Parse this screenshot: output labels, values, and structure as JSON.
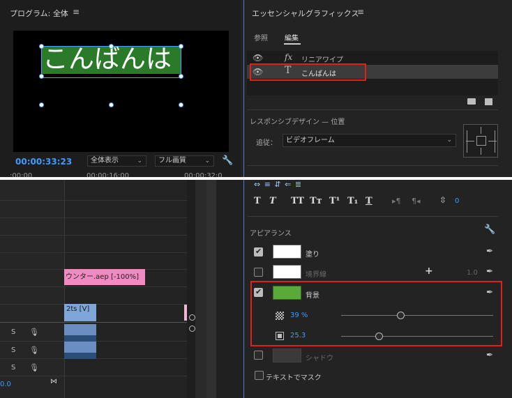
{
  "program_monitor": {
    "title": "プログラム: 全体",
    "menu_icon": "hamburger-icon",
    "title_text": "こんばんは",
    "timecode": "00:00:33:23",
    "fit_dropdown": "全体表示",
    "quality_dropdown": "フル画質",
    "wrench_icon": "wrench-icon",
    "ruler": [
      ":00:00",
      "00:00:16:00",
      "00:00:32:0"
    ]
  },
  "timeline": {
    "pink_clip_label": "ウンター.aep [-100%]",
    "blue_clip_label": "2ts [V]",
    "audio_tracks": [
      {
        "s": "S",
        "mic": "🎙"
      },
      {
        "s": "S",
        "mic": "🎙"
      },
      {
        "s": "S",
        "mic": "🎙"
      }
    ],
    "zero_label": "0.0",
    "end_mark": "⋈"
  },
  "essential_graphics": {
    "title": "エッセンシャルグラフィックス",
    "menu_icon": "hamburger-icon",
    "tabs": {
      "browse": "参照",
      "edit": "編集"
    },
    "layers": [
      {
        "icon": "fx",
        "name": "リニアワイプ",
        "selected": false
      },
      {
        "icon": "T",
        "name": "こんばんは",
        "selected": true
      }
    ],
    "responsive_label": "レスポンシブデザイン — 位置",
    "follow_label": "追従：",
    "follow_value": "ビデオフレーム",
    "text_toolbar_row": "⇔ ≡ ⇵ ⇐ ≣",
    "text_styles": [
      "T",
      "T",
      "TT",
      "Tт",
      "T¹",
      "T₁",
      "T"
    ],
    "tsume_value": "0",
    "appearance_label": "アピアランス",
    "appearance": {
      "fill_label": "塗り",
      "stroke_label": "境界線",
      "stroke_value": "1.0",
      "background_label": "背景",
      "opacity_value": "39 %",
      "opacity_fraction": 0.39,
      "size_value": "25.3",
      "size_fraction": 0.25,
      "shadow_label": "シャドウ",
      "mask_label": "テキストでマスク",
      "fill_color": "#ffffff",
      "stroke_color": "#ffffff",
      "background_color": "#5aaa3a"
    },
    "highlight_color": "#e0201c",
    "accent_color": "#3f9bff"
  }
}
